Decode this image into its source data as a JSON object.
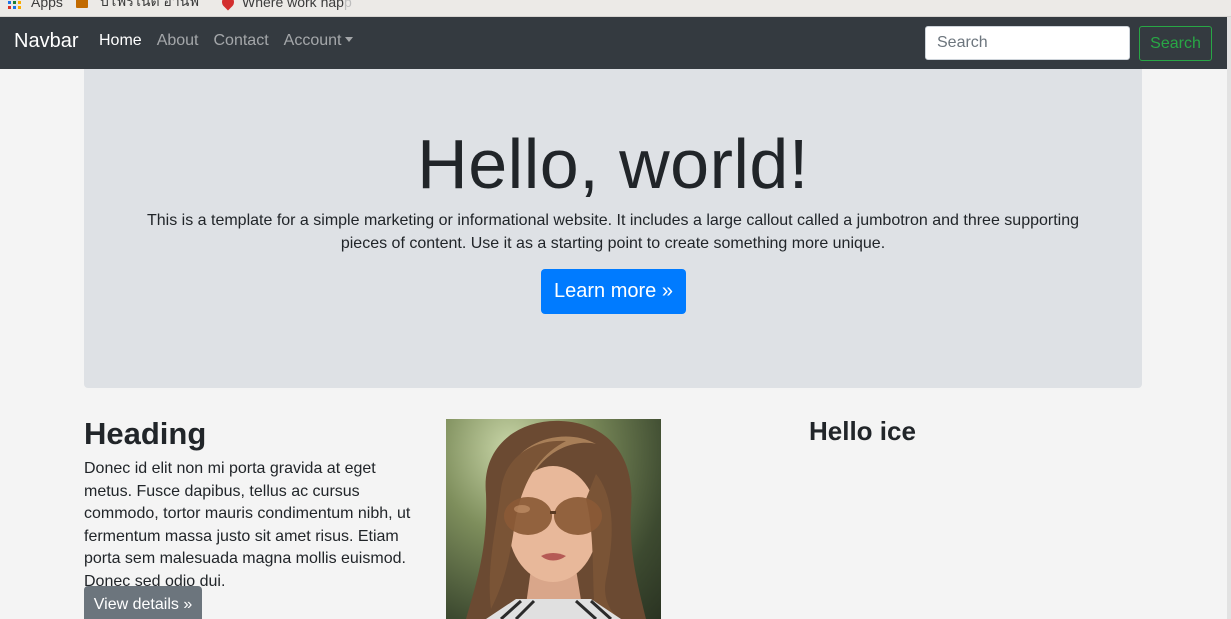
{
  "bookmarks": {
    "apps_label": "Apps",
    "item2_label": "บิโฟร์ไนต์ อ่านฟ",
    "item3_label": "Where work hap",
    "item3_fade": "p"
  },
  "navbar": {
    "brand": "Navbar",
    "links": [
      {
        "label": "Home",
        "active": true
      },
      {
        "label": "About"
      },
      {
        "label": "Contact"
      },
      {
        "label": "Account"
      }
    ],
    "search_placeholder": "Search",
    "search_button": "Search",
    "search_button_color": "#28a745",
    "background": "#343a40"
  },
  "jumbotron": {
    "title": "Hello, world!",
    "text": "This is a template for a simple marketing or informational website. It includes a large callout called a jumbotron and three supporting pieces of content. Use it as a starting point to create something more unique.",
    "button": "Learn more »",
    "button_color": "#007bff"
  },
  "columns": {
    "first": {
      "heading": "Heading",
      "text": "Donec id elit non mi porta gravida at eget metus. Fusce dapibus, tellus ac cursus commodo, tortor mauris condimentum nibh, ut fermentum massa justo sit amet risus. Etiam porta sem malesuada magna mollis euismod. Donec sed odio dui.",
      "button": "View details »"
    },
    "second": {
      "image": "woman-with-sunglasses-photo"
    },
    "third": {
      "heading": "Hello ice"
    }
  }
}
